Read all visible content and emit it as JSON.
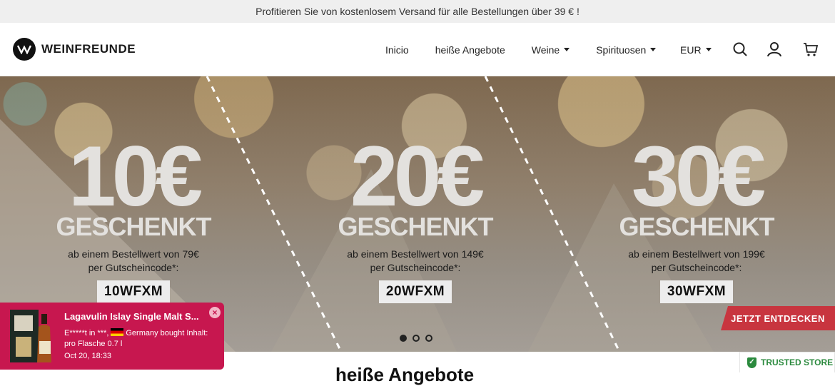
{
  "announcement": "Profitieren Sie von kostenlosem Versand für alle Bestellungen über 39 € !",
  "brand": {
    "name": "WEINFREUNDE",
    "logo_mark": "W"
  },
  "nav": {
    "items": [
      {
        "label": "Inicio",
        "dropdown": false
      },
      {
        "label": "heiße Angebote",
        "dropdown": false
      },
      {
        "label": "Weine",
        "dropdown": true
      },
      {
        "label": "Spirituosen",
        "dropdown": true
      }
    ],
    "currency": "EUR",
    "icons": [
      "search-icon",
      "account-icon",
      "cart-icon"
    ]
  },
  "hero": {
    "offers": [
      {
        "amount": "10€",
        "label": "GESCHENKT",
        "line1": "ab einem Bestellwert von 79€",
        "line2": "per Gutscheincode*:",
        "code": "10WFXM"
      },
      {
        "amount": "20€",
        "label": "GESCHENKT",
        "line1": "ab einem Bestellwert von 149€",
        "line2": "per Gutscheincode*:",
        "code": "20WFXM"
      },
      {
        "amount": "30€",
        "label": "GESCHENKT",
        "line1": "ab einem Bestellwert von 199€",
        "line2": "per Gutscheincode*:",
        "code": "30WFXM"
      }
    ],
    "cta": "JETZT ENTDECKEN",
    "slides": 3,
    "active_slide": 1
  },
  "popup": {
    "title": "Lagavulin Islay Single Malt S...",
    "line1_prefix": "E*****t in ***,",
    "line1_suffix": "Germany bought Inhalt:",
    "line2": "pro Flasche 0.7 l",
    "line3": "Oct 20, 18:33",
    "close": "×"
  },
  "trusted": "TRUSTED STORE",
  "below_heading": "heiße Angebote"
}
